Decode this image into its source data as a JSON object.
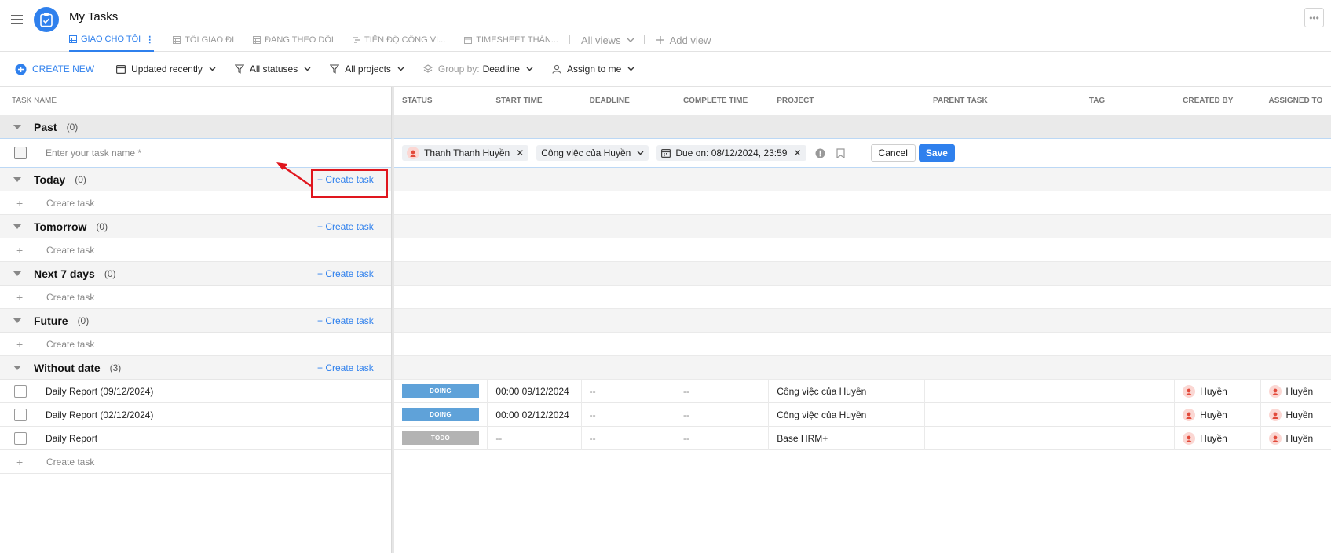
{
  "app": {
    "title": "My Tasks",
    "more_label": "•••"
  },
  "views": {
    "tabs": [
      {
        "label": "GIAO CHO TÔI",
        "active": true,
        "icon": "table-icon"
      },
      {
        "label": "TÔI GIAO ĐI",
        "active": false,
        "icon": "table-icon"
      },
      {
        "label": "ĐANG THEO DÕI",
        "active": false,
        "icon": "table-icon"
      },
      {
        "label": "TIẾN ĐỘ CÔNG VI...",
        "active": false,
        "icon": "gantt-icon"
      },
      {
        "label": "TIMESHEET THÁN...",
        "active": false,
        "icon": "calendar-icon"
      }
    ],
    "all_views": "All views",
    "add_view": "Add view"
  },
  "toolbar": {
    "create_new": "CREATE NEW",
    "sort": "Updated recently",
    "statuses": "All statuses",
    "projects": "All projects",
    "group_by_label": "Group by:",
    "group_by_value": "Deadline",
    "assign": "Assign to me"
  },
  "left": {
    "header": "TASK NAME",
    "create_task": "Create task",
    "input_placeholder": "Enter your task name *",
    "groups": [
      {
        "name": "Past",
        "count": "(0)"
      },
      {
        "name": "Today",
        "count": "(0)"
      },
      {
        "name": "Tomorrow",
        "count": "(0)"
      },
      {
        "name": "Next 7 days",
        "count": "(0)"
      },
      {
        "name": "Future",
        "count": "(0)"
      },
      {
        "name": "Without date",
        "count": "(3)"
      }
    ],
    "create_plus": "+ Create task",
    "tasks": [
      {
        "name": "Daily Report (09/12/2024)"
      },
      {
        "name": "Daily Report (02/12/2024)"
      },
      {
        "name": "Daily Report"
      }
    ]
  },
  "right": {
    "columns": [
      "STATUS",
      "START TIME",
      "DEADLINE",
      "COMPLETE TIME",
      "PROJECT",
      "PARENT TASK",
      "TAG",
      "CREATED BY",
      "ASSIGNED TO"
    ],
    "entry": {
      "assignee": "Thanh Thanh Huyền",
      "project": "Công việc của Huyền",
      "due": "Due on: 08/12/2024, 23:59",
      "cancel": "Cancel",
      "save": "Save"
    },
    "rows": [
      {
        "status": "DOING",
        "start": "00:00 09/12/2024",
        "deadline": "--",
        "complete": "--",
        "project": "Công việc của Huyền",
        "created_by": "Huyền",
        "assigned_to": "Huyền"
      },
      {
        "status": "DOING",
        "start": "00:00 02/12/2024",
        "deadline": "--",
        "complete": "--",
        "project": "Công việc của Huyền",
        "created_by": "Huyền",
        "assigned_to": "Huyền"
      },
      {
        "status": "TODO",
        "start": "--",
        "deadline": "--",
        "complete": "--",
        "project": "Base HRM+",
        "created_by": "Huyền",
        "assigned_to": "Huyền"
      }
    ]
  },
  "colors": {
    "accent": "#2f80ed",
    "doing": "#5fa2d9",
    "todo": "#b3b3b3",
    "highlight": "#e0161e"
  }
}
